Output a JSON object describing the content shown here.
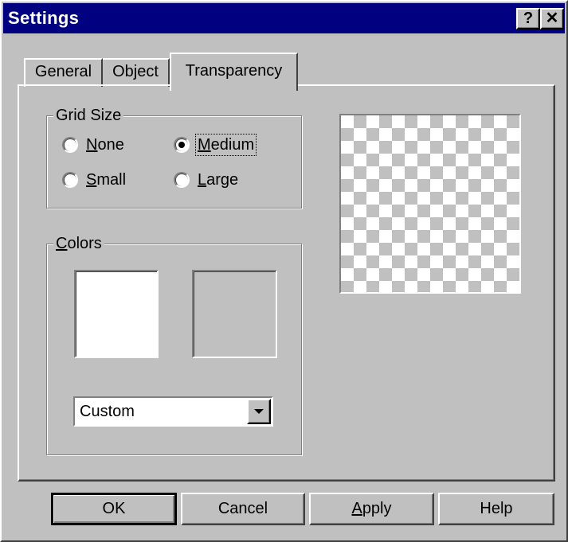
{
  "window": {
    "title": "Settings",
    "help_glyph": "?",
    "close_glyph": "✕"
  },
  "tabs": [
    {
      "label": "General",
      "selected": false
    },
    {
      "label": "Object",
      "selected": false
    },
    {
      "label": "Transparency",
      "selected": true
    }
  ],
  "grid_size": {
    "legend": "Grid Size",
    "options": [
      {
        "label_hotkey": "N",
        "label_rest": "one",
        "checked": false
      },
      {
        "label_hotkey": "M",
        "label_rest": "edium",
        "checked": true
      },
      {
        "label_hotkey": "S",
        "label_rest": "mall",
        "checked": false
      },
      {
        "label_hotkey": "L",
        "label_rest": "arge",
        "checked": false
      }
    ]
  },
  "colors": {
    "legend_hotkey": "C",
    "legend_rest": "olors",
    "swatch_primary": "#ffffff",
    "swatch_secondary": "#c0c0c0",
    "preset_value": "Custom"
  },
  "buttons": {
    "ok": "OK",
    "cancel": "Cancel",
    "apply_hotkey": "A",
    "apply_rest": "pply",
    "help": "Help"
  },
  "theme": {
    "titlebar": "#000080",
    "face": "#c0c0c0"
  }
}
